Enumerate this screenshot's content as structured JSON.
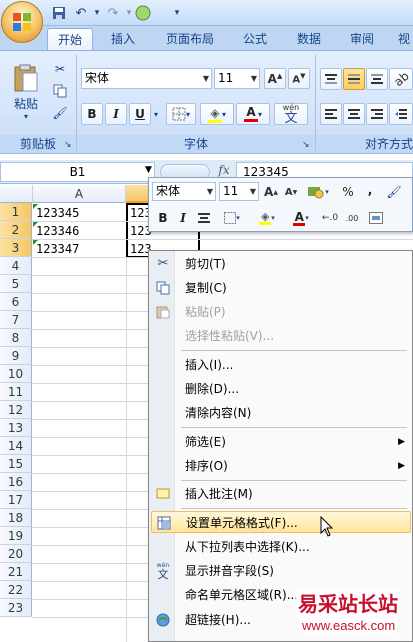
{
  "quick_access": {
    "save_icon": "save-icon",
    "undo_icon": "undo-icon",
    "redo_icon": "redo-icon"
  },
  "tabs": [
    {
      "label": "开始",
      "active": true
    },
    {
      "label": "插入"
    },
    {
      "label": "页面布局"
    },
    {
      "label": "公式"
    },
    {
      "label": "数据"
    },
    {
      "label": "审阅"
    },
    {
      "label": "视"
    }
  ],
  "ribbon": {
    "clipboard": {
      "paste_label": "粘贴",
      "group_label": "剪贴板"
    },
    "font": {
      "font_name": "宋体",
      "font_size": "11",
      "group_label": "字体",
      "bold": "B",
      "italic": "I",
      "underline": "U",
      "pinyin": "wén"
    },
    "alignment": {
      "group_label": "对齐方式"
    }
  },
  "formula_bar": {
    "name_box": "B1",
    "fx_label": "fx",
    "content": "123345"
  },
  "columns": [
    "A"
  ],
  "rows": [
    "1",
    "2",
    "3",
    "4",
    "5",
    "6",
    "7",
    "8",
    "9",
    "10",
    "11",
    "12",
    "13",
    "14",
    "15",
    "16",
    "17",
    "18",
    "19",
    "20",
    "21",
    "22",
    "23"
  ],
  "cells": {
    "A1": "123345",
    "A2": "123346",
    "A3": "123347",
    "B1": "123",
    "B2": "123",
    "B3": "123"
  },
  "mini_toolbar": {
    "font_name": "宋体",
    "font_size": "11",
    "percent": "%",
    "comma": ",",
    "bold": "B",
    "italic": "I"
  },
  "context_menu": [
    {
      "label": "剪切(T)",
      "icon": "scissors-icon"
    },
    {
      "label": "复制(C)",
      "icon": "copy-icon"
    },
    {
      "label": "粘贴(P)",
      "icon": "paste-icon",
      "disabled": true
    },
    {
      "label": "选择性粘贴(V)...",
      "disabled": true
    },
    {
      "label": "插入(I)..."
    },
    {
      "label": "删除(D)..."
    },
    {
      "label": "清除内容(N)"
    },
    {
      "label": "筛选(E)",
      "submenu": true
    },
    {
      "label": "排序(O)",
      "submenu": true
    },
    {
      "label": "插入批注(M)",
      "icon": "comment-icon"
    },
    {
      "label": "设置单元格格式(F)...",
      "icon": "format-cells-icon",
      "highlighted": true
    },
    {
      "label": "从下拉列表中选择(K)..."
    },
    {
      "label": "显示拼音字段(S)",
      "icon": "pinyin-icon"
    },
    {
      "label": "命名单元格区域(R)..."
    },
    {
      "label": "超链接(H)...",
      "icon": "hyperlink-icon"
    }
  ],
  "watermark": {
    "line1": "易采站长站",
    "line2": "www.easck.com"
  },
  "colors": {
    "accent": "#15428b",
    "highlight": "#ffe59a",
    "ribbon": "#d5e5fa"
  }
}
